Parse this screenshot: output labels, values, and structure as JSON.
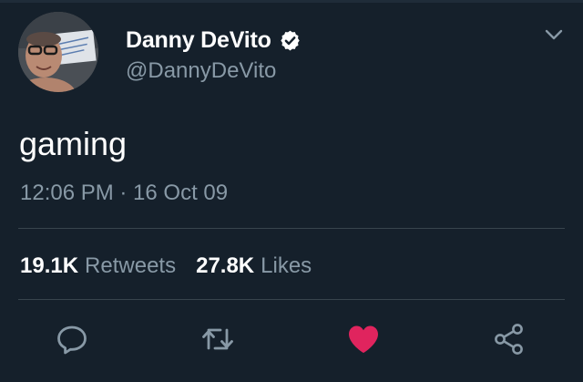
{
  "user": {
    "display_name": "Danny DeVito",
    "handle": "@DannyDeVito",
    "verified_icon": "verified-badge-icon"
  },
  "tweet": {
    "text": "gaming",
    "timestamp": "12:06 PM · 16 Oct 09"
  },
  "stats": {
    "retweets_count": "19.1K",
    "retweets_label": "Retweets",
    "likes_count": "27.8K",
    "likes_label": "Likes"
  },
  "actions": {
    "reply_icon": "reply-icon",
    "retweet_icon": "retweet-icon",
    "like_icon": "heart-icon",
    "share_icon": "share-icon",
    "liked": true
  },
  "colors": {
    "background": "#15202b",
    "secondary_text": "#8899a6",
    "like_active": "#e0245e",
    "divider": "#38444d"
  }
}
